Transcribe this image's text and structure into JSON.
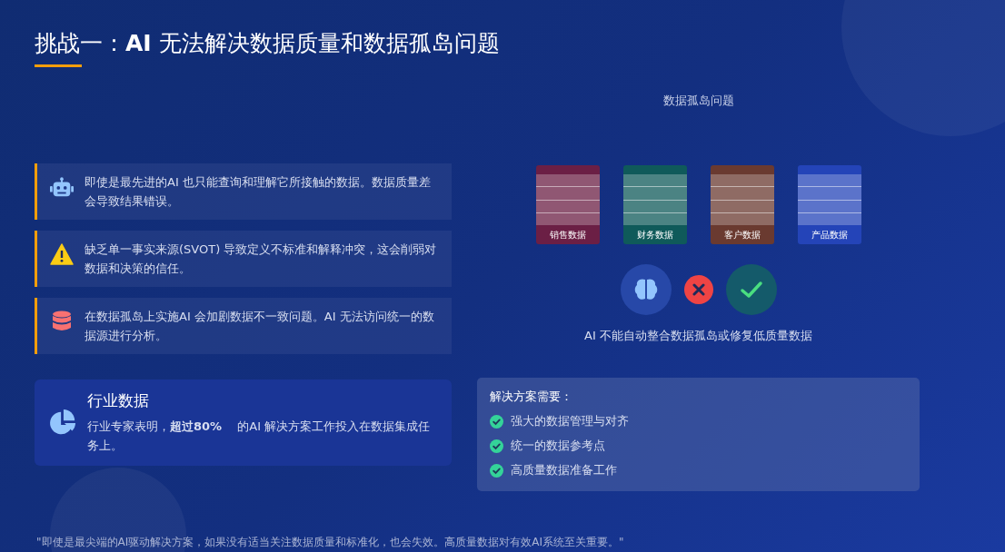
{
  "title": "挑战一：**AI** 无法解决数据质量和数据孤岛问题",
  "points": [
    {
      "kind": "robot",
      "text": "即使是最先进的AI 也只能查询和理解它所接触的数据。数据质量差会导致结果错误。"
    },
    {
      "kind": "warning",
      "text": "缺乏单一事实来源(SVOT) 导致定义不标准和解释冲突，这会削弱对数据和决策的信任。"
    },
    {
      "kind": "database",
      "text": "在数据孤岛上实施AI 会加剧数据不一致问题。AI 无法访问统一的数据源进行分析。"
    }
  ],
  "industry": {
    "title": "行业数据",
    "text": "行业专家表明，**超过80%** 　的AI 解决方案工作投入在数据集成任务上。"
  },
  "silos": {
    "title": "数据孤岛问题",
    "items": [
      {
        "label": "销售数据",
        "color": "#6b1f45"
      },
      {
        "label": "财务数据",
        "color": "#0f5a5a"
      },
      {
        "label": "客户数据",
        "color": "#6a3a30"
      },
      {
        "label": "产品数据",
        "color": "#2444b8"
      }
    ],
    "caption": "AI 不能自动整合数据孤岛或修复低质量数据"
  },
  "solution": {
    "title": "解决方案需要：",
    "items": [
      "强大的数据管理与对齐",
      "统一的数据参考点",
      "高质量数据准备工作"
    ]
  },
  "footer": "\"即使是最尖端的AI驱动解决方案，如果没有适当关注数据质量和标准化，也会失效。高质量数据对有效AI系统至关重要。\""
}
